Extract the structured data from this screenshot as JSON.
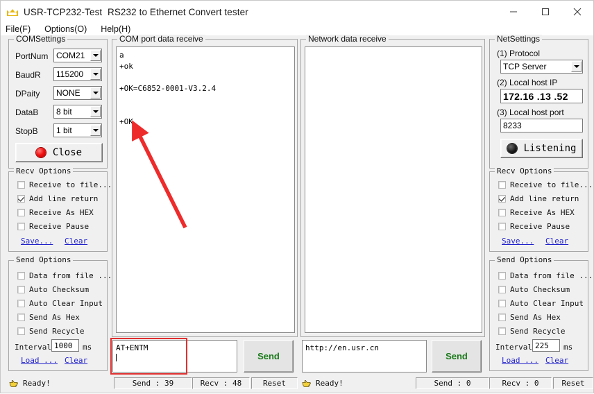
{
  "window": {
    "title": "USR-TCP232-Test  RS232 to Ethernet Convert tester",
    "icon": "crown-icon",
    "minimize": "minimize-icon",
    "maximize": "maximize-icon",
    "close": "close-icon"
  },
  "menu": {
    "file": "File(F)",
    "options": "Options(O)",
    "help": "Help(H)"
  },
  "com_settings": {
    "legend": "COMSettings",
    "port_label": "PortNum",
    "port_value": "COM21",
    "baud_label": "BaudR",
    "baud_value": "115200",
    "parity_label": "DPaity",
    "parity_value": "NONE",
    "data_label": "DataB",
    "data_value": "8 bit",
    "stop_label": "StopB",
    "stop_value": "1 bit",
    "connect_button": "Close",
    "led_state": "red"
  },
  "left_recv": {
    "legend": "Recv Options",
    "items": [
      {
        "label": "Receive to file...",
        "checked": false
      },
      {
        "label": "Add line return",
        "checked": true
      },
      {
        "label": "Receive As HEX",
        "checked": false
      },
      {
        "label": "Receive Pause",
        "checked": false
      }
    ],
    "save_link": "Save...",
    "clear_link": "Clear"
  },
  "left_send": {
    "legend": "Send Options",
    "items": [
      {
        "label": "Data from file ...",
        "checked": false
      },
      {
        "label": "Auto Checksum",
        "checked": false
      },
      {
        "label": "Auto Clear Input",
        "checked": false
      },
      {
        "label": "Send As Hex",
        "checked": false
      },
      {
        "label": "Send Recycle",
        "checked": false
      }
    ],
    "interval_label": "Interval",
    "interval_value": "1000",
    "interval_unit": "ms",
    "load_link": "Load ...",
    "clear_link": "Clear"
  },
  "com_receive": {
    "legend": "COM port data receive",
    "text": "a\n+ok\n\n+OK=C6852-0001-V3.2.4\n\n\n+OK"
  },
  "net_receive": {
    "legend": "Network data receive",
    "text": ""
  },
  "com_send": {
    "value": "AT+ENTM",
    "button": "Send",
    "highlighted": true
  },
  "net_send": {
    "value": "http://en.usr.cn",
    "button": "Send"
  },
  "net_settings": {
    "legend": "NetSettings",
    "protocol_label": "(1) Protocol",
    "protocol_value": "TCP Server",
    "ip_label": "(2) Local host IP",
    "ip_value": "172.16 .13 .52",
    "port_label": "(3) Local host port",
    "port_value": "8233",
    "listen_button": "Listening",
    "led_state": "black"
  },
  "right_recv": {
    "legend": "Recv Options",
    "items": [
      {
        "label": "Receive to file...",
        "checked": false
      },
      {
        "label": "Add line return",
        "checked": true
      },
      {
        "label": "Receive As HEX",
        "checked": false
      },
      {
        "label": "Receive Pause",
        "checked": false
      }
    ],
    "save_link": "Save...",
    "clear_link": "Clear"
  },
  "right_send": {
    "legend": "Send Options",
    "items": [
      {
        "label": "Data from file ...",
        "checked": false
      },
      {
        "label": "Auto Checksum",
        "checked": false
      },
      {
        "label": "Auto Clear Input",
        "checked": false
      },
      {
        "label": "Send As Hex",
        "checked": false
      },
      {
        "label": "Send Recycle",
        "checked": false
      }
    ],
    "interval_label": "Interval",
    "interval_value": "225",
    "interval_unit": "ms",
    "load_link": "Load ...",
    "clear_link": "Clear"
  },
  "left_status": {
    "ready": "Ready!",
    "send": "Send : 39",
    "recv": "Recv : 48",
    "reset": "Reset"
  },
  "right_status": {
    "ready": "Ready!",
    "send": "Send : 0",
    "recv": "Recv : 0",
    "reset": "Reset"
  },
  "annotation": {
    "arrow_color": "#ee2b2b",
    "highlight_color": "#e03030"
  }
}
